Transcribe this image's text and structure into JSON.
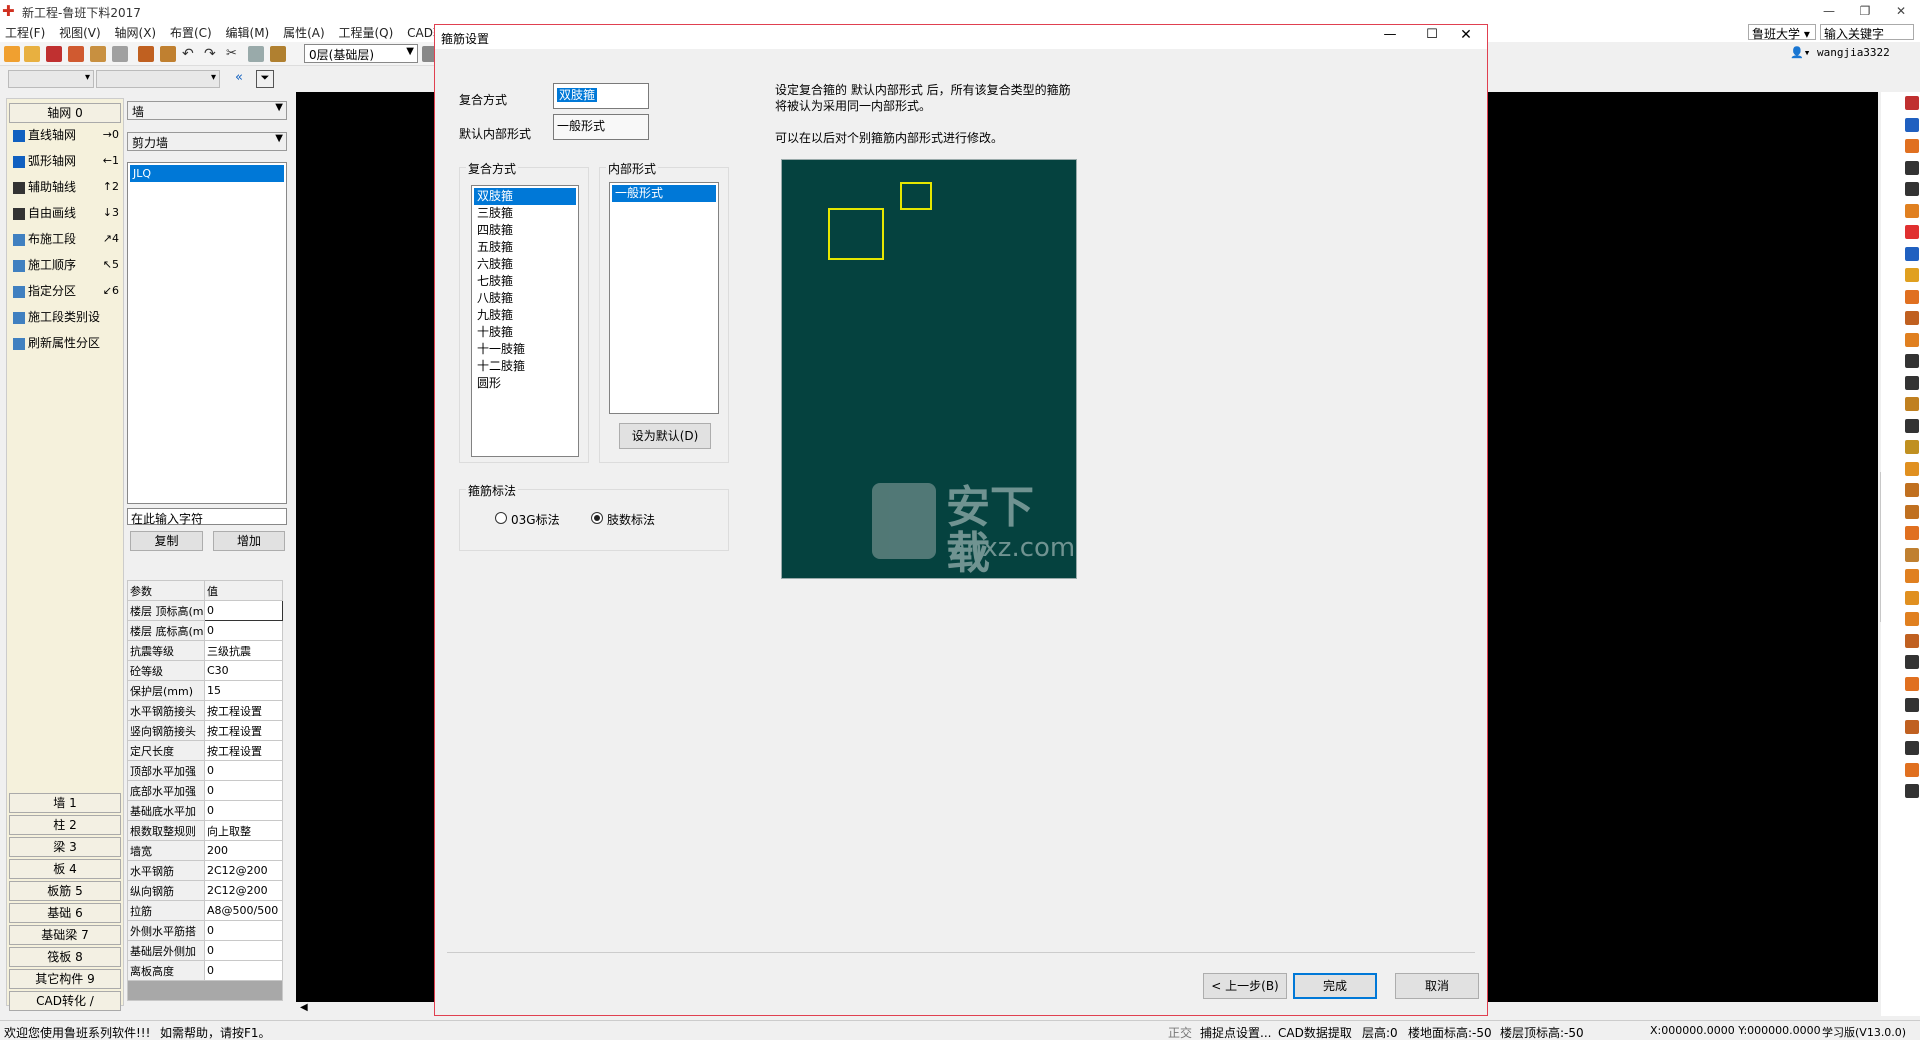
{
  "app": {
    "title": "新工程-鲁班下料2017",
    "logo": "鲁班-logo"
  },
  "menu": [
    "工程(F)",
    "视图(V)",
    "轴网(X)",
    "布置(C)",
    "编辑(M)",
    "属性(A)",
    "工程量(Q)",
    "CAD转"
  ],
  "top_right": {
    "school": "鲁班大学",
    "keyword_placeholder": "输入关键字",
    "user": "wangjia3322"
  },
  "toolbar": {
    "floor": "0层(基础层)"
  },
  "left_panel": {
    "axis_header": "轴网 0",
    "items": [
      {
        "label": "直线轴网",
        "key": "→0"
      },
      {
        "label": "弧形轴网",
        "key": "←1"
      },
      {
        "label": "辅助轴线",
        "key": "↑2"
      },
      {
        "label": "自由画线",
        "key": "↓3"
      },
      {
        "label": "布施工段",
        "key": "↗4"
      },
      {
        "label": "施工顺序",
        "key": "↖5"
      },
      {
        "label": "指定分区",
        "key": "↙6"
      },
      {
        "label": "施工段类别设",
        "key": ""
      },
      {
        "label": "刷新属性分区",
        "key": ""
      }
    ],
    "categories": [
      "墙 1",
      "柱 2",
      "梁 3",
      "板 4",
      "板筋 5",
      "基础 6",
      "基础梁 7",
      "筏板 8",
      "其它构件 9",
      "CAD转化 /"
    ]
  },
  "mid_panel": {
    "combo1": "墙",
    "combo2": "剪力墙",
    "list": [
      "JLQ"
    ],
    "search_placeholder": "在此输入字符",
    "copy_btn": "复制",
    "add_btn": "增加",
    "table_header": [
      "参数",
      "值"
    ],
    "rows": [
      [
        "楼层 顶标高(m",
        "0"
      ],
      [
        "楼层 底标高(m",
        "0"
      ],
      [
        "抗震等级",
        "三级抗震"
      ],
      [
        "砼等级",
        "C30"
      ],
      [
        "保护层(mm)",
        "15"
      ],
      [
        "水平钢筋接头",
        "按工程设置"
      ],
      [
        "竖向钢筋接头",
        "按工程设置"
      ],
      [
        "定尺长度",
        "按工程设置"
      ],
      [
        "顶部水平加强",
        "0"
      ],
      [
        "底部水平加强",
        "0"
      ],
      [
        "基础底水平加",
        "0"
      ],
      [
        "根数取整规则",
        "向上取整"
      ],
      [
        "墙宽",
        "200"
      ],
      [
        "水平钢筋",
        "2C12@200"
      ],
      [
        "纵向钢筋",
        "2C12@200"
      ],
      [
        "拉筋",
        "A8@500/500"
      ],
      [
        "外侧水平筋搭",
        "0"
      ],
      [
        "基础层外侧加",
        "0"
      ],
      [
        "离板高度",
        "0"
      ]
    ]
  },
  "dialog": {
    "title": "箍筋设置",
    "combo_label": "复合方式",
    "combo_value": "双肢箍",
    "default_label": "默认内部形式",
    "default_value": "一般形式",
    "desc1": "设定复合箍的 默认内部形式 后，所有该复合类型的箍筋",
    "desc2": "将被认为采用同一内部形式。",
    "desc3": "可以在以后对个别箍筋内部形式进行修改。",
    "group1": "复合方式",
    "list1": [
      "双肢箍",
      "三肢箍",
      "四肢箍",
      "五肢箍",
      "六肢箍",
      "七肢箍",
      "八肢箍",
      "九肢箍",
      "十肢箍",
      "十一肢箍",
      "十二肢箍",
      "圆形"
    ],
    "group2": "内部形式",
    "list2": [
      "一般形式"
    ],
    "set_default": "设为默认(D)",
    "group3": "箍筋标法",
    "radio1": "03G标法",
    "radio2": "肢数标法",
    "prev": "< 上一步(B)",
    "finish": "完成",
    "cancel": "取消",
    "watermark_text": "安下载",
    "watermark_sub": "anxz.com"
  },
  "status": {
    "welcome": "欢迎您使用鲁班系列软件!!!",
    "help": "如需帮助，请按F1。",
    "ortho": "正交",
    "snap": "捕捉点设置...",
    "cad": "CAD数据提取",
    "layer": "层高:0",
    "floor_elev": "楼地面标高:-50",
    "floor_top": "楼层顶标高:-50",
    "coords": "X:000000.0000 Y:000000.0000",
    "version": "学习版(V13.0.0)"
  }
}
